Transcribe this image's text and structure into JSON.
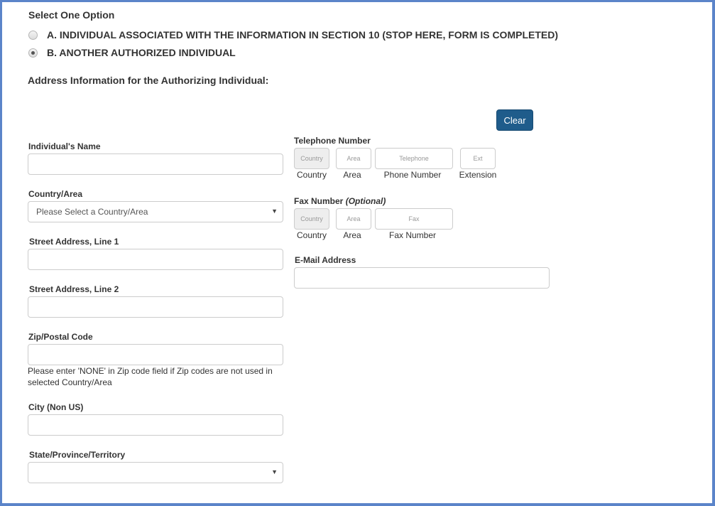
{
  "options": {
    "title": "Select One Option",
    "items": [
      {
        "label": "A. INDIVIDUAL ASSOCIATED WITH THE INFORMATION IN SECTION 10 (STOP HERE, FORM IS COMPLETED)",
        "checked": false
      },
      {
        "label": "B. ANOTHER AUTHORIZED INDIVIDUAL",
        "checked": true
      }
    ]
  },
  "address_section": {
    "title": "Address Information for the Authorizing Individual:",
    "clear_label": "Clear",
    "name": {
      "label": "Individual's Name",
      "value": ""
    },
    "country": {
      "label": "Country/Area",
      "selected": "Please Select a Country/Area"
    },
    "street1": {
      "label": "Street Address, Line 1",
      "value": ""
    },
    "street2": {
      "label": "Street Address, Line 2",
      "value": ""
    },
    "zip": {
      "label": "Zip/Postal Code",
      "value": "",
      "help": "Please enter 'NONE' in Zip code field if Zip codes are not used in selected Country/Area"
    },
    "city": {
      "label": "City (Non US)",
      "value": ""
    },
    "state": {
      "label": "State/Province/Territory",
      "selected": ""
    }
  },
  "telephone": {
    "label": "Telephone Number",
    "fields": [
      {
        "placeholder": "Country",
        "caption": "Country",
        "disabled": true
      },
      {
        "placeholder": "Area",
        "caption": "Area"
      },
      {
        "placeholder": "Telephone",
        "caption": "Phone Number"
      },
      {
        "placeholder": "Ext",
        "caption": "Extension"
      }
    ]
  },
  "fax": {
    "label": "Fax Number",
    "optional": "(Optional)",
    "fields": [
      {
        "placeholder": "Country",
        "caption": "Country",
        "disabled": true
      },
      {
        "placeholder": "Area",
        "caption": "Area"
      },
      {
        "placeholder": "Fax",
        "caption": "Fax Number"
      }
    ]
  },
  "email": {
    "label": "E-Mail Address",
    "value": ""
  },
  "colors": {
    "frame": "#5b84c9",
    "button": "#1f5c8b"
  }
}
